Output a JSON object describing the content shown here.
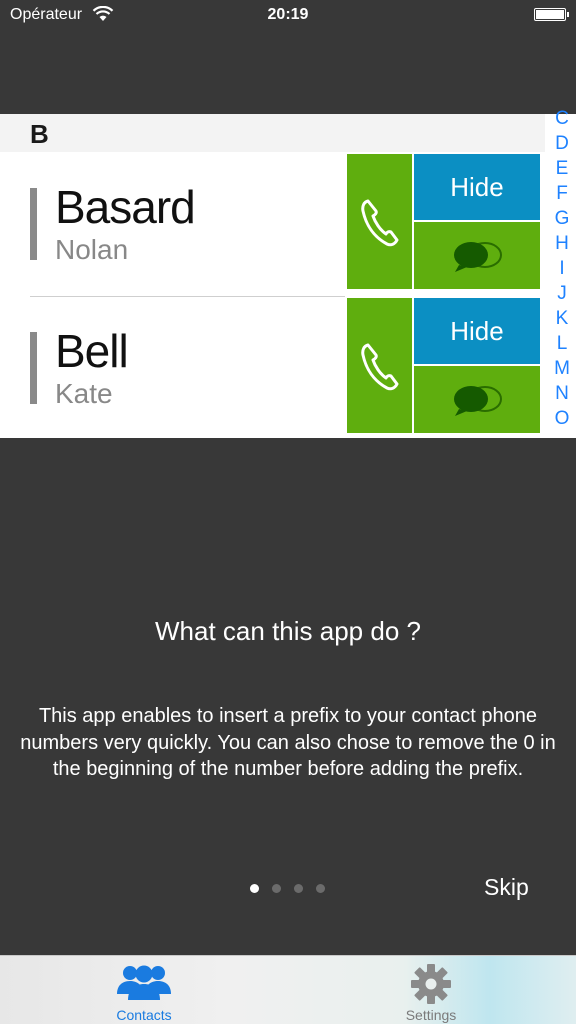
{
  "status_bar": {
    "carrier": "Opérateur",
    "time": "20:19"
  },
  "contacts": {
    "section_letter": "B",
    "rows": [
      {
        "last_name": "Basard",
        "first_name": "Nolan",
        "hide_label": "Hide"
      },
      {
        "last_name": "Bell",
        "first_name": "Kate",
        "hide_label": "Hide"
      }
    ],
    "index_letters": [
      "C",
      "D",
      "E",
      "F",
      "G",
      "H",
      "I",
      "J",
      "K",
      "L",
      "M",
      "N",
      "O"
    ]
  },
  "onboarding": {
    "title": "What can this app do ?",
    "description": "This app enables to insert a prefix to your contact phone numbers very quickly. You can also chose to remove the 0 in the beginning of the number before adding the prefix.",
    "page_count": 4,
    "current_page": 1,
    "skip_label": "Skip"
  },
  "tab_bar": {
    "tabs": [
      {
        "label": "Contacts",
        "icon": "contacts-icon",
        "selected": true
      },
      {
        "label": "Settings",
        "icon": "gear-icon",
        "selected": false
      }
    ]
  },
  "colors": {
    "call_green": "#5fae0e",
    "hide_blue": "#0b8fc3",
    "index_blue": "#1e82ff",
    "overlay": "#383838"
  }
}
